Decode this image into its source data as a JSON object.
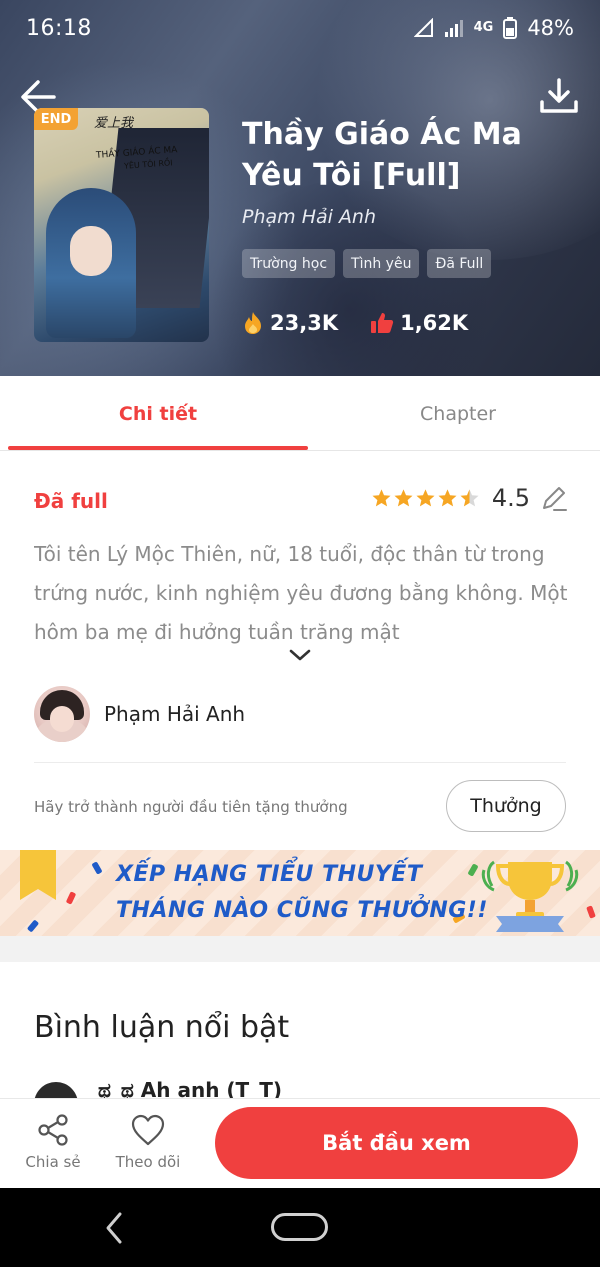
{
  "status_bar": {
    "time": "16:18",
    "network": "4G",
    "battery": "48%"
  },
  "book": {
    "badge": "END",
    "title": "Thầy Giáo Ác Ma Yêu Tôi [Full]",
    "author": "Phạm Hải Anh",
    "tags": [
      "Trường học",
      "Tình yêu",
      "Đã Full"
    ],
    "views": "23,3K",
    "likes": "1,62K",
    "cover_text": {
      "top": "爱上我",
      "line1": "THẦY GIÁO ÁC MA",
      "line2": "YÊU TÔI RỒI"
    }
  },
  "tabs": {
    "detail": "Chi tiết",
    "chapter": "Chapter"
  },
  "detail": {
    "status": "Đã full",
    "rating": "4.5",
    "rating_stars": 4.5,
    "synopsis": "Tôi tên Lý Mộc Thiên, nữ, 18 tuổi, độc thân từ trong trứng nước, kinh nghiệm yêu đương bằng không. Một hôm ba mẹ đi hưởng tuần trăng mật",
    "author_name": "Phạm Hải Anh",
    "reward_hint": "Hãy trở thành người đầu tiên tặng thưởng",
    "reward_button": "Thưởng"
  },
  "banner": {
    "line1": "XẾP HẠNG TIỂU THUYẾT",
    "line2": "THÁNG NÀO CŨNG THƯỞNG!!"
  },
  "comments": {
    "title": "Bình luận nổi bật",
    "first_user": "ಥ_ಥ Ah anh (T_T)"
  },
  "bottom_bar": {
    "share": "Chia sẻ",
    "follow": "Theo dõi",
    "start": "Bắt đầu xem"
  },
  "colors": {
    "accent": "#f0403f",
    "banner_text": "#1f5bc8",
    "gold": "#f6a623"
  },
  "icons": [
    "back-arrow-icon",
    "download-icon",
    "fire-icon",
    "thumbs-up-icon",
    "star-icon",
    "edit-icon",
    "chevron-down-icon",
    "share-icon",
    "heart-icon"
  ]
}
